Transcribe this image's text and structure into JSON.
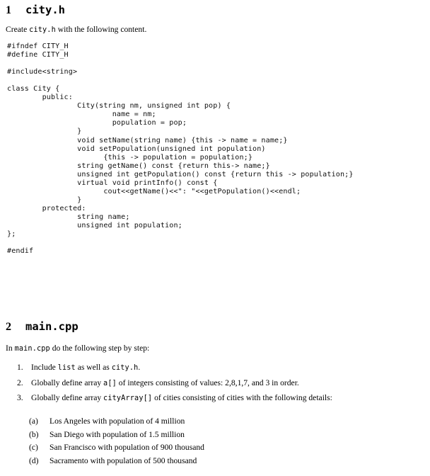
{
  "document": {
    "sections": [
      {
        "number": "1",
        "title": "city.h",
        "intro_prefix": "Create ",
        "intro_mono": "city.h",
        "intro_suffix": " with the following content."
      },
      {
        "number": "2",
        "title": "main.cpp",
        "intro_prefix": "In ",
        "intro_mono": "main.cpp",
        "intro_suffix": " do the following step by step:"
      }
    ],
    "code_lines": [
      "#ifndef CITY_H",
      "#define CITY_H",
      "",
      "#include<string>",
      "",
      "class City {",
      "        public:",
      "                City(string nm, unsigned int pop) {",
      "                        name = nm;",
      "                        population = pop;",
      "                }",
      "                void setName(string name) {this -> name = name;}",
      "                void setPopulation(unsigned int population)",
      "                      {this -> population = population;}",
      "                string getName() const {return this-> name;}",
      "                unsigned int getPopulation() const {return this -> population;}",
      "                virtual void printInfo() const {",
      "                      cout<<getName()<<\": \"<<getPopulation()<<endl;",
      "                }",
      "        protected:",
      "                string name;",
      "                unsigned int population;",
      "};",
      "",
      "#endif"
    ],
    "steps": [
      {
        "marker": "1.",
        "parts": [
          {
            "type": "text",
            "value": "Include "
          },
          {
            "type": "mono",
            "value": "list"
          },
          {
            "type": "text",
            "value": " as well as "
          },
          {
            "type": "mono",
            "value": "city.h"
          },
          {
            "type": "text",
            "value": "."
          }
        ]
      },
      {
        "marker": "2.",
        "parts": [
          {
            "type": "text",
            "value": "Globally define array "
          },
          {
            "type": "mono",
            "value": "a[]"
          },
          {
            "type": "text",
            "value": " of integers consisting of values: 2,8,1,7, and 3 in order."
          }
        ]
      },
      {
        "marker": "3.",
        "parts": [
          {
            "type": "text",
            "value": "Globally define array "
          },
          {
            "type": "mono",
            "value": "cityArray[]"
          },
          {
            "type": "text",
            "value": " of cities consisting of cities with the following details:"
          }
        ]
      }
    ],
    "city_details": [
      {
        "marker": "(a)",
        "text": "Los Angeles with population of 4 million"
      },
      {
        "marker": "(b)",
        "text": "San Diego with population of 1.5 million"
      },
      {
        "marker": "(c)",
        "text": "San Francisco with population of 900 thousand"
      },
      {
        "marker": "(d)",
        "text": "Sacramento with population of 500 thousand"
      }
    ]
  }
}
